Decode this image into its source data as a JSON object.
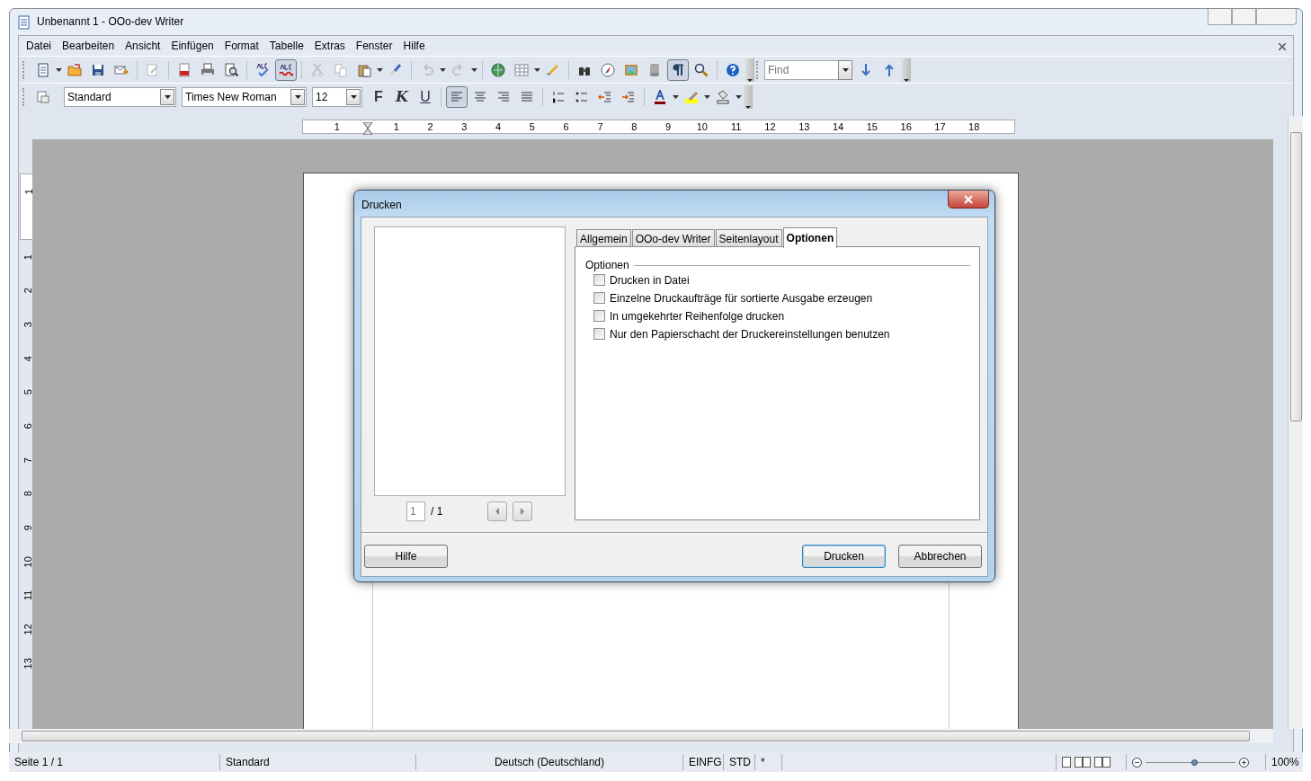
{
  "window": {
    "title": "Unbenannt 1 - OOo-dev Writer"
  },
  "menu": [
    "Datei",
    "Bearbeiten",
    "Ansicht",
    "Einfügen",
    "Format",
    "Tabelle",
    "Extras",
    "Fenster",
    "Hilfe"
  ],
  "toolbar": {
    "autospellcheck": true,
    "formatting_marks": true,
    "find_placeholder": "Find"
  },
  "formatting": {
    "style": "Standard",
    "font": "Times New Roman",
    "size": "12",
    "bold": "F",
    "italic": "K",
    "underline": "U",
    "align_left": true
  },
  "ruler": {
    "left_label": "1",
    "labels": [
      "1",
      "2",
      "3",
      "4",
      "5",
      "6",
      "7",
      "8",
      "9",
      "10",
      "11",
      "12",
      "13",
      "14",
      "15",
      "16",
      "17",
      "18"
    ]
  },
  "vertical_ruler": {
    "top_label": "1",
    "labels": [
      "1",
      "2",
      "3",
      "4",
      "5",
      "6",
      "7",
      "8",
      "9",
      "10",
      "11",
      "12",
      "13"
    ]
  },
  "dialog": {
    "title": "Drucken",
    "page_field": "1",
    "page_total": "/ 1",
    "tabs": [
      {
        "label": "Allgemein",
        "selected": false
      },
      {
        "label": "OOo-dev Writer",
        "selected": false
      },
      {
        "label": "Seitenlayout",
        "selected": false
      },
      {
        "label": "Optionen",
        "selected": true
      }
    ],
    "group": "Optionen",
    "options": [
      {
        "label": "Drucken in Datei",
        "checked": false
      },
      {
        "label": "Einzelne Druckaufträge für sortierte Ausgabe erzeugen",
        "checked": false
      },
      {
        "label": "In umgekehrter Reihenfolge drucken",
        "checked": false
      },
      {
        "label": "Nur den Papierschacht der Druckereinstellungen benutzen",
        "checked": false
      }
    ],
    "buttons": [
      {
        "label": "Hilfe",
        "kind": "help",
        "default": false
      },
      {
        "label": "Drucken",
        "kind": "action",
        "default": true
      },
      {
        "label": "Abbrechen",
        "kind": "action",
        "default": false
      }
    ]
  },
  "status_bar": {
    "page": "Seite 1 / 1",
    "style": "Standard",
    "language": "Deutsch (Deutschland)",
    "insert_mode": "EINFG",
    "selection_mode": "STD",
    "modified": "*",
    "zoom_slider": {
      "level": 0.55
    },
    "zoom": "100%"
  }
}
